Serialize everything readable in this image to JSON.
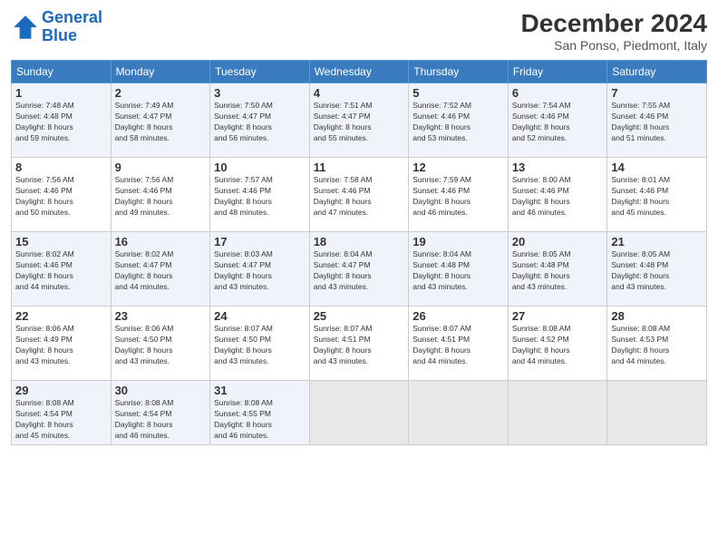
{
  "header": {
    "logo_line1": "General",
    "logo_line2": "Blue",
    "month": "December 2024",
    "location": "San Ponso, Piedmont, Italy"
  },
  "weekdays": [
    "Sunday",
    "Monday",
    "Tuesday",
    "Wednesday",
    "Thursday",
    "Friday",
    "Saturday"
  ],
  "weeks": [
    [
      {
        "day": 1,
        "info": "Sunrise: 7:48 AM\nSunset: 4:48 PM\nDaylight: 8 hours\nand 59 minutes."
      },
      {
        "day": 2,
        "info": "Sunrise: 7:49 AM\nSunset: 4:47 PM\nDaylight: 8 hours\nand 58 minutes."
      },
      {
        "day": 3,
        "info": "Sunrise: 7:50 AM\nSunset: 4:47 PM\nDaylight: 8 hours\nand 56 minutes."
      },
      {
        "day": 4,
        "info": "Sunrise: 7:51 AM\nSunset: 4:47 PM\nDaylight: 8 hours\nand 55 minutes."
      },
      {
        "day": 5,
        "info": "Sunrise: 7:52 AM\nSunset: 4:46 PM\nDaylight: 8 hours\nand 53 minutes."
      },
      {
        "day": 6,
        "info": "Sunrise: 7:54 AM\nSunset: 4:46 PM\nDaylight: 8 hours\nand 52 minutes."
      },
      {
        "day": 7,
        "info": "Sunrise: 7:55 AM\nSunset: 4:46 PM\nDaylight: 8 hours\nand 51 minutes."
      }
    ],
    [
      {
        "day": 8,
        "info": "Sunrise: 7:56 AM\nSunset: 4:46 PM\nDaylight: 8 hours\nand 50 minutes."
      },
      {
        "day": 9,
        "info": "Sunrise: 7:56 AM\nSunset: 4:46 PM\nDaylight: 8 hours\nand 49 minutes."
      },
      {
        "day": 10,
        "info": "Sunrise: 7:57 AM\nSunset: 4:46 PM\nDaylight: 8 hours\nand 48 minutes."
      },
      {
        "day": 11,
        "info": "Sunrise: 7:58 AM\nSunset: 4:46 PM\nDaylight: 8 hours\nand 47 minutes."
      },
      {
        "day": 12,
        "info": "Sunrise: 7:59 AM\nSunset: 4:46 PM\nDaylight: 8 hours\nand 46 minutes."
      },
      {
        "day": 13,
        "info": "Sunrise: 8:00 AM\nSunset: 4:46 PM\nDaylight: 8 hours\nand 46 minutes."
      },
      {
        "day": 14,
        "info": "Sunrise: 8:01 AM\nSunset: 4:46 PM\nDaylight: 8 hours\nand 45 minutes."
      }
    ],
    [
      {
        "day": 15,
        "info": "Sunrise: 8:02 AM\nSunset: 4:46 PM\nDaylight: 8 hours\nand 44 minutes."
      },
      {
        "day": 16,
        "info": "Sunrise: 8:02 AM\nSunset: 4:47 PM\nDaylight: 8 hours\nand 44 minutes."
      },
      {
        "day": 17,
        "info": "Sunrise: 8:03 AM\nSunset: 4:47 PM\nDaylight: 8 hours\nand 43 minutes."
      },
      {
        "day": 18,
        "info": "Sunrise: 8:04 AM\nSunset: 4:47 PM\nDaylight: 8 hours\nand 43 minutes."
      },
      {
        "day": 19,
        "info": "Sunrise: 8:04 AM\nSunset: 4:48 PM\nDaylight: 8 hours\nand 43 minutes."
      },
      {
        "day": 20,
        "info": "Sunrise: 8:05 AM\nSunset: 4:48 PM\nDaylight: 8 hours\nand 43 minutes."
      },
      {
        "day": 21,
        "info": "Sunrise: 8:05 AM\nSunset: 4:48 PM\nDaylight: 8 hours\nand 43 minutes."
      }
    ],
    [
      {
        "day": 22,
        "info": "Sunrise: 8:06 AM\nSunset: 4:49 PM\nDaylight: 8 hours\nand 43 minutes."
      },
      {
        "day": 23,
        "info": "Sunrise: 8:06 AM\nSunset: 4:50 PM\nDaylight: 8 hours\nand 43 minutes."
      },
      {
        "day": 24,
        "info": "Sunrise: 8:07 AM\nSunset: 4:50 PM\nDaylight: 8 hours\nand 43 minutes."
      },
      {
        "day": 25,
        "info": "Sunrise: 8:07 AM\nSunset: 4:51 PM\nDaylight: 8 hours\nand 43 minutes."
      },
      {
        "day": 26,
        "info": "Sunrise: 8:07 AM\nSunset: 4:51 PM\nDaylight: 8 hours\nand 44 minutes."
      },
      {
        "day": 27,
        "info": "Sunrise: 8:08 AM\nSunset: 4:52 PM\nDaylight: 8 hours\nand 44 minutes."
      },
      {
        "day": 28,
        "info": "Sunrise: 8:08 AM\nSunset: 4:53 PM\nDaylight: 8 hours\nand 44 minutes."
      }
    ],
    [
      {
        "day": 29,
        "info": "Sunrise: 8:08 AM\nSunset: 4:54 PM\nDaylight: 8 hours\nand 45 minutes."
      },
      {
        "day": 30,
        "info": "Sunrise: 8:08 AM\nSunset: 4:54 PM\nDaylight: 8 hours\nand 46 minutes."
      },
      {
        "day": 31,
        "info": "Sunrise: 8:08 AM\nSunset: 4:55 PM\nDaylight: 8 hours\nand 46 minutes."
      },
      {
        "day": null
      },
      {
        "day": null
      },
      {
        "day": null
      },
      {
        "day": null
      }
    ]
  ]
}
